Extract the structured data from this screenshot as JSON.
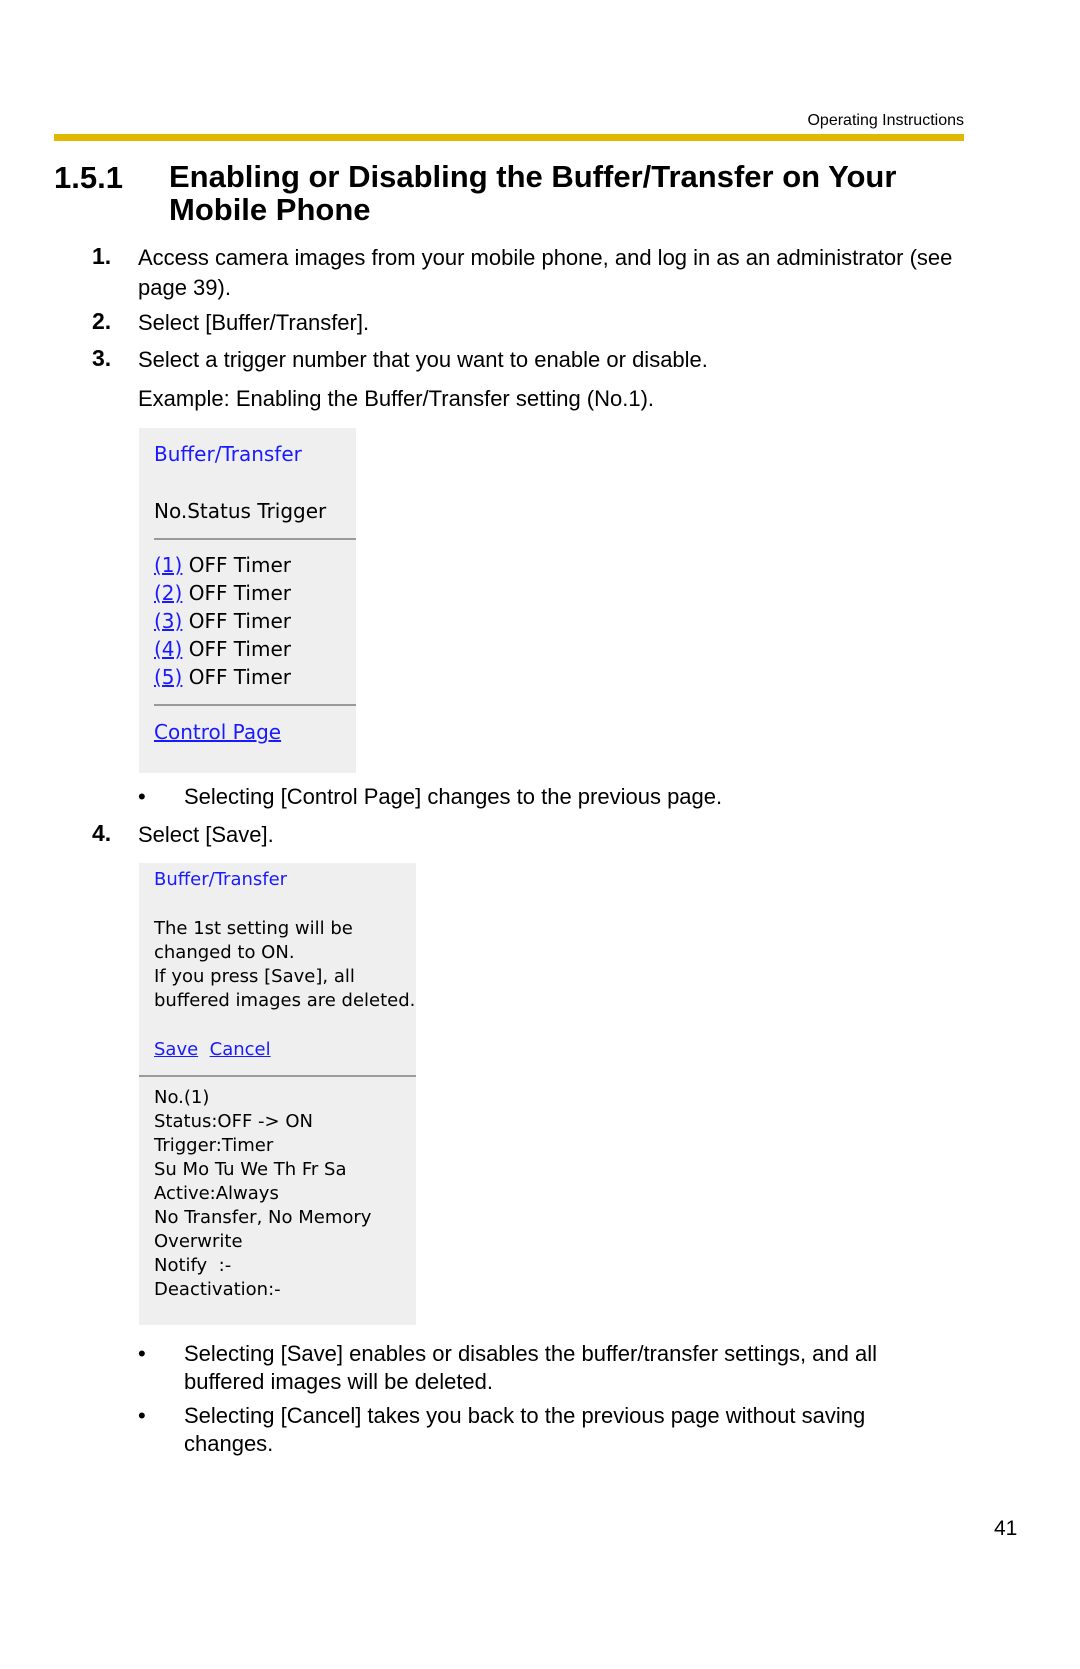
{
  "header": {
    "label": "Operating Instructions"
  },
  "section": {
    "number": "1.5.1",
    "title": "Enabling or Disabling the Buffer/Transfer on Your Mobile Phone"
  },
  "steps": [
    {
      "num": "1.",
      "text": "Access camera images from your mobile phone, and log in as an administrator (see page 39)."
    },
    {
      "num": "2.",
      "text": "Select [Buffer/Transfer]."
    },
    {
      "num": "3.",
      "text": "Select a trigger number that you want to enable or disable."
    },
    {
      "num": "4.",
      "text": "Select [Save]."
    }
  ],
  "example_text": "Example: Enabling the Buffer/Transfer setting (No.1).",
  "screen1": {
    "title": "Buffer/Transfer",
    "header": "No.Status Trigger",
    "rows": [
      {
        "link": "(1)",
        "text": "OFF Timer"
      },
      {
        "link": "(2)",
        "text": "OFF Timer"
      },
      {
        "link": "(3)",
        "text": "OFF Timer"
      },
      {
        "link": "(4)",
        "text": "OFF Timer"
      },
      {
        "link": "(5)",
        "text": "OFF Timer"
      }
    ],
    "control_link": "Control Page"
  },
  "bullet1": "Selecting [Control Page] changes to the previous page.",
  "screen2": {
    "title": "Buffer/Transfer",
    "message": [
      "The 1st setting will be",
      "changed to ON.",
      "If you press [Save], all",
      "buffered images are deleted."
    ],
    "save": "Save",
    "cancel": "Cancel",
    "details": [
      "No.(1)",
      "Status:OFF -> ON",
      "Trigger:Timer",
      "Su Mo Tu We Th Fr Sa",
      "Active:Always",
      "No Transfer, No Memory",
      "Overwrite",
      "Notify  :-",
      "Deactivation:-"
    ]
  },
  "bullets2": [
    "Selecting [Save] enables or disables the buffer/transfer settings, and all buffered images will be deleted.",
    "Selecting [Cancel] takes you back to the previous page without saving changes."
  ],
  "page_number": "41"
}
